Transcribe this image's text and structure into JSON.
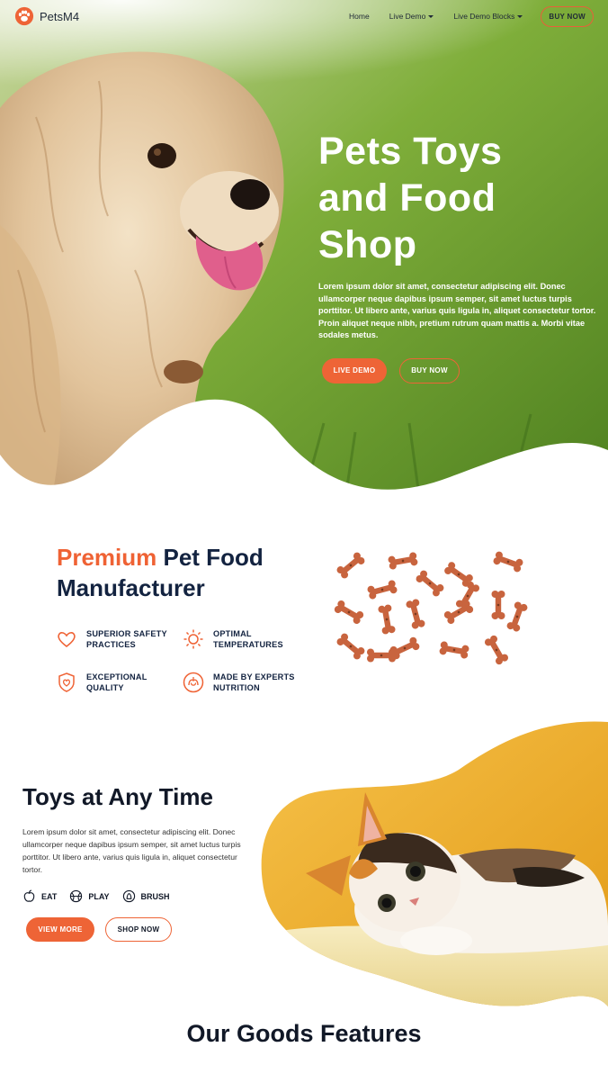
{
  "brand": {
    "name": "PetsM4",
    "logo_icon": "paw-icon",
    "accent_color": "#ee6436",
    "dark_color": "#132340"
  },
  "nav": {
    "home": "Home",
    "live_demo": "Live Demo",
    "live_demo_blocks": "Live Demo Blocks",
    "buy_now": "BUY NOW"
  },
  "hero": {
    "title": "Pets Toys and Food Shop",
    "description": "Lorem ipsum dolor sit amet, consectetur adipiscing elit. Donec ullamcorper neque dapibus ipsum semper, sit amet luctus turpis porttitor. Ut libero ante, varius quis ligula in, aliquet consectetur tortor. Proin aliquet neque nibh, pretium rutrum quam mattis a. Morbi vitae sodales metus.",
    "btn_live": "LIVE DEMO",
    "btn_buy": "BUY NOW",
    "image": "dog-photo"
  },
  "premium": {
    "title_accent": "Premium",
    "title_rest": "Pet Food Manufacturer",
    "features": [
      {
        "label_line1": "SUPERIOR SAFETY",
        "label_line2": "PRACTICES",
        "icon": "heart-icon"
      },
      {
        "label_line1": "OPTIMAL",
        "label_line2": "TEMPERATURES",
        "icon": "sun-icon"
      },
      {
        "label_line1": "EXCEPTIONAL",
        "label_line2": "QUALITY",
        "icon": "shield-heart-icon"
      },
      {
        "label_line1": "MADE BY EXPERTS",
        "label_line2": "NUTRITION",
        "icon": "nutrition-icon"
      }
    ],
    "image": "dog-treat-bones"
  },
  "toys": {
    "title": "Toys at Any Time",
    "description": "Lorem ipsum dolor sit amet, consectetur adipiscing elit. Donec ullamcorper neque dapibus ipsum semper, sit amet luctus turpis porttitor. Ut libero ante, varius quis ligula in, aliquet consectetur tortor.",
    "tags": [
      {
        "label": "EAT",
        "icon": "apple-icon"
      },
      {
        "label": "PLAY",
        "icon": "ball-icon"
      },
      {
        "label": "BRUSH",
        "icon": "brush-icon"
      }
    ],
    "btn_view": "VIEW MORE",
    "btn_shop": "SHOP NOW",
    "image": "kitten-photo"
  },
  "goods": {
    "title": "Our Goods Features"
  }
}
